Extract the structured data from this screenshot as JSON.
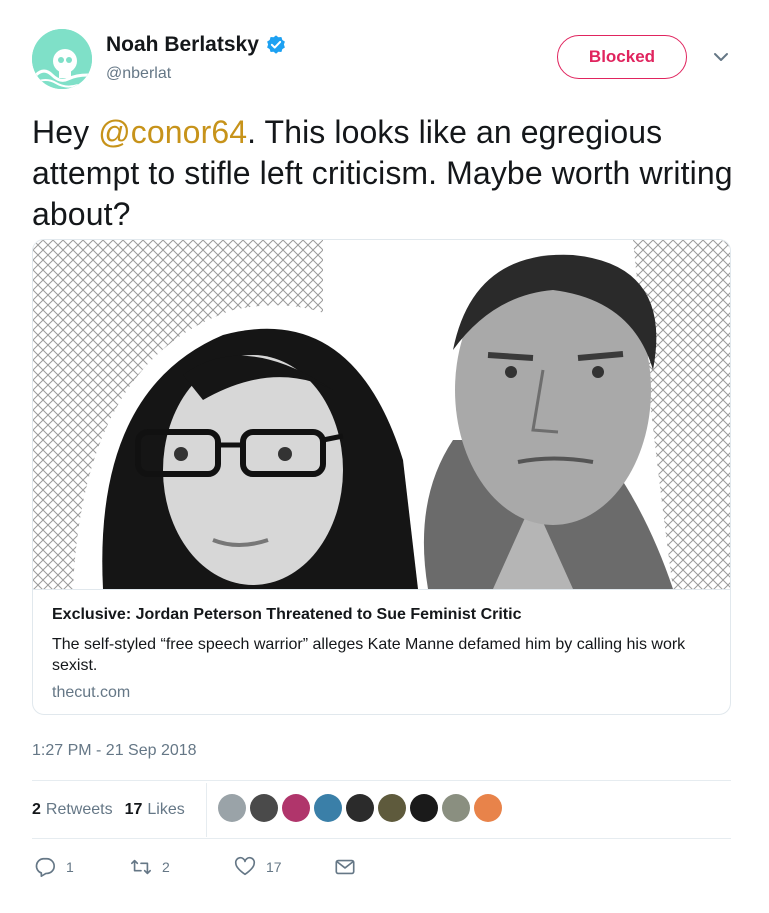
{
  "header": {
    "display_name": "Noah Berlatsky",
    "handle": "@nberlat",
    "blocked_label": "Blocked",
    "icons": {
      "avatar": "skull-avatar",
      "verified": "verified-badge-icon",
      "menu": "chevron-down-icon"
    }
  },
  "tweet": {
    "text_before": "Hey ",
    "mention": "@conor64",
    "text_after": ". This looks like an egregious attempt to stifle left criticism. Maybe worth writing about?"
  },
  "card": {
    "title": "Exclusive: Jordan Peterson Threatened to Sue Feminist Critic",
    "description": "The self-styled “free speech warrior” alleges Kate Manne defamed him by calling his work sexist.",
    "domain": "thecut.com"
  },
  "timestamp": "1:27 PM - 21 Sep 2018",
  "stats": {
    "retweets_count": "2",
    "retweets_label": "Retweets",
    "likes_count": "17",
    "likes_label": "Likes"
  },
  "likers": [
    {
      "name": "liker-1",
      "color": "#9aa3a8"
    },
    {
      "name": "liker-2",
      "color": "#4a4a4a"
    },
    {
      "name": "liker-3",
      "color": "#b0356b"
    },
    {
      "name": "liker-4",
      "color": "#3a7fa8"
    },
    {
      "name": "liker-5",
      "color": "#2b2b2b"
    },
    {
      "name": "liker-6",
      "color": "#5e5a3c"
    },
    {
      "name": "liker-7",
      "color": "#1a1a1a"
    },
    {
      "name": "liker-8",
      "color": "#8a8f80"
    },
    {
      "name": "liker-9",
      "color": "#e8834a"
    }
  ],
  "actions": {
    "reply_count": "1",
    "retweet_count": "2",
    "like_count": "17",
    "icons": [
      "reply-icon",
      "retweet-icon",
      "like-icon",
      "message-icon"
    ]
  },
  "colors": {
    "blocked": "#e0245e",
    "mention": "#c7931a",
    "verified": "#1da1f2",
    "secondary_text": "#657786"
  }
}
